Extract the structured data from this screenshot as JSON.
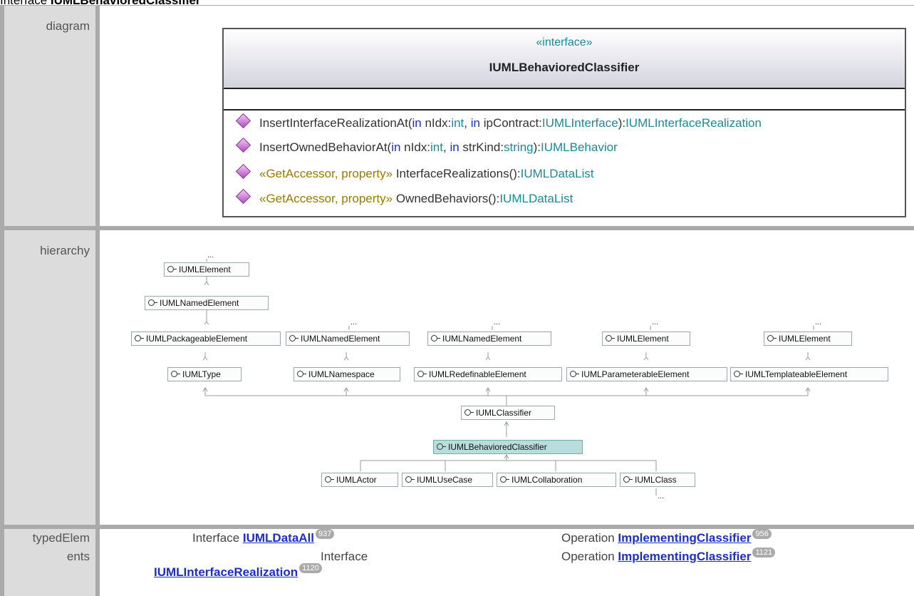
{
  "page_title": {
    "prefix": "Interface ",
    "name": "IUMLBehavioredClassifier"
  },
  "rows": {
    "diagram": "diagram",
    "hierarchy": "hierarchy",
    "typedElements_1": "typedElem",
    "typedElements_2": "ents"
  },
  "uml": {
    "stereotype": "«interface»",
    "class_name": "IUMLBehavioredClassifier",
    "ops": [
      {
        "name": "InsertInterfaceRealizationAt(",
        "k1": "in",
        "p1": " nIdx:",
        "t1": "int",
        "sep": ", ",
        "k2": "in",
        "p2": " ipContract:",
        "t2": "IUMLInterface",
        "close": "):",
        "ret": "IUMLInterfaceRealization"
      },
      {
        "name": "InsertOwnedBehaviorAt(",
        "k1": "in",
        "p1": " nIdx:",
        "t1": "int",
        "sep": ", ",
        "k2": "in",
        "p2": " strKind:",
        "t2": "string",
        "close": "):",
        "ret": "IUMLBehavior"
      },
      {
        "stereo": "«GetAccessor, property»",
        "name": " InterfaceRealizations():",
        "ret": "IUMLDataList"
      },
      {
        "stereo": "«GetAccessor, property»",
        "name": " OwnedBehaviors():",
        "ret": "IUMLDataList"
      }
    ]
  },
  "hierarchy": {
    "ellipsis": "...",
    "nodes": {
      "elem1": "IUMLElement",
      "named1": "IUMLNamedElement",
      "pack": "IUMLPackageableElement",
      "named2": "IUMLNamedElement",
      "named3": "IUMLNamedElement",
      "elem2": "IUMLElement",
      "elem3": "IUMLElement",
      "type": "IUMLType",
      "namespace": "IUMLNamespace",
      "redef": "IUMLRedefinableElement",
      "param": "IUMLParameterableElement",
      "templ": "IUMLTemplateableElement",
      "classifier": "IUMLClassifier",
      "behav": "IUMLBehavioredClassifier",
      "actor": "IUMLActor",
      "usecase": "IUMLUseCase",
      "collab": "IUMLCollaboration",
      "class": "IUMLClass"
    }
  },
  "typed": {
    "items": [
      {
        "kind": "Interface ",
        "name": "IUMLDataAll",
        "badge": "937"
      },
      {
        "kind": "Operation ",
        "name": "ImplementingClassifier",
        "badge": "956"
      },
      {
        "kind": "Interface",
        "name": "IUMLInterfaceRealization",
        "badge": "1120"
      },
      {
        "kind": "Operation ",
        "name": "ImplementingClassifier",
        "badge": "1121"
      }
    ]
  }
}
